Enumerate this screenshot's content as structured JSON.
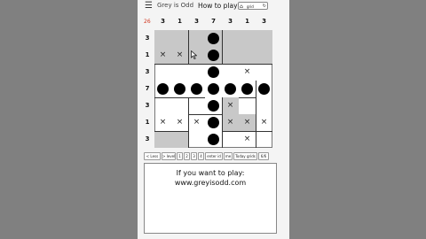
{
  "header": {
    "menu_icon": "hamburger-icon",
    "title": "Grey is Odd",
    "how_to_play": "How to play",
    "home_button": {
      "icon": "home-icon",
      "label": "grid",
      "icon2": "refresh-icon"
    }
  },
  "puzzle": {
    "count": "26",
    "column_clues": [
      "3",
      "1",
      "3",
      "7",
      "3",
      "1",
      "3"
    ],
    "row_clues": [
      "3",
      "1",
      "3",
      "7",
      "3",
      "1",
      "3"
    ],
    "cells": [
      [
        "grey",
        "grey",
        "grey",
        "dot-grey",
        "grey",
        "grey",
        "grey"
      ],
      [
        "x-grey",
        "x-grey",
        "grey",
        "dot-grey",
        "grey",
        "grey",
        "grey"
      ],
      [
        "white",
        "white",
        "white",
        "dot",
        "white",
        "x",
        "white"
      ],
      [
        "dot",
        "dot",
        "dot",
        "dot",
        "dot",
        "dot",
        "dot"
      ],
      [
        "white",
        "white",
        "white",
        "dot",
        "x-grey",
        "white",
        "white"
      ],
      [
        "x",
        "x",
        "x",
        "dot",
        "x-grey",
        "x-grey",
        "x"
      ],
      [
        "grey",
        "grey",
        "white",
        "dot",
        "white",
        "x",
        "white"
      ]
    ]
  },
  "toolbar": {
    "buttons": [
      "< Less",
      "> level",
      "1",
      "2",
      "3",
      "4",
      "enter id",
      "me",
      "Today grids",
      "6/6"
    ]
  },
  "message": {
    "line1": "If you want to play:",
    "line2": "www.greyisodd.com"
  },
  "colors": {
    "grey_cell": "#c8c8c8",
    "counter": "#d2361e",
    "background": "#808080",
    "panel": "#f4f4f4"
  }
}
